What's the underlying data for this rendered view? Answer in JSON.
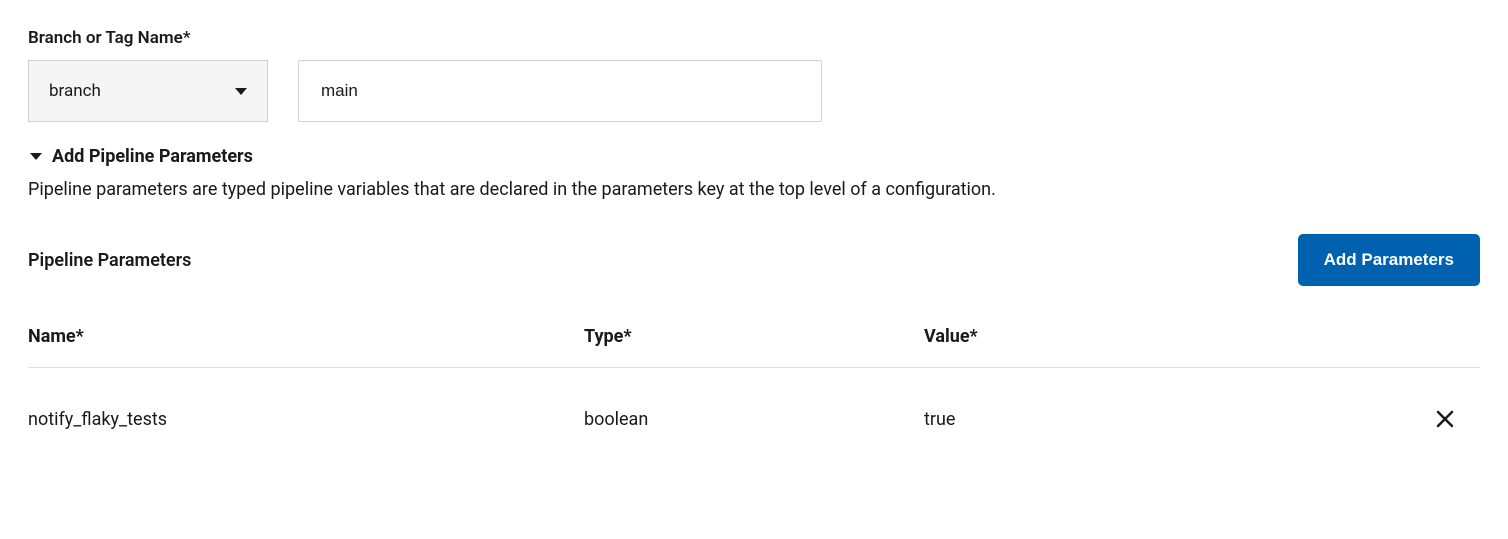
{
  "branch": {
    "label": "Branch or Tag Name*",
    "select_value": "branch",
    "input_value": "main"
  },
  "collapse": {
    "title": "Add Pipeline Parameters",
    "description": "Pipeline parameters are typed pipeline variables that are declared in the parameters key at the top level of a configuration."
  },
  "params": {
    "title": "Pipeline Parameters",
    "add_button": "Add Parameters",
    "columns": {
      "name": "Name*",
      "type": "Type*",
      "value": "Value*"
    },
    "rows": [
      {
        "name": "notify_flaky_tests",
        "type": "boolean",
        "value": "true"
      }
    ]
  }
}
